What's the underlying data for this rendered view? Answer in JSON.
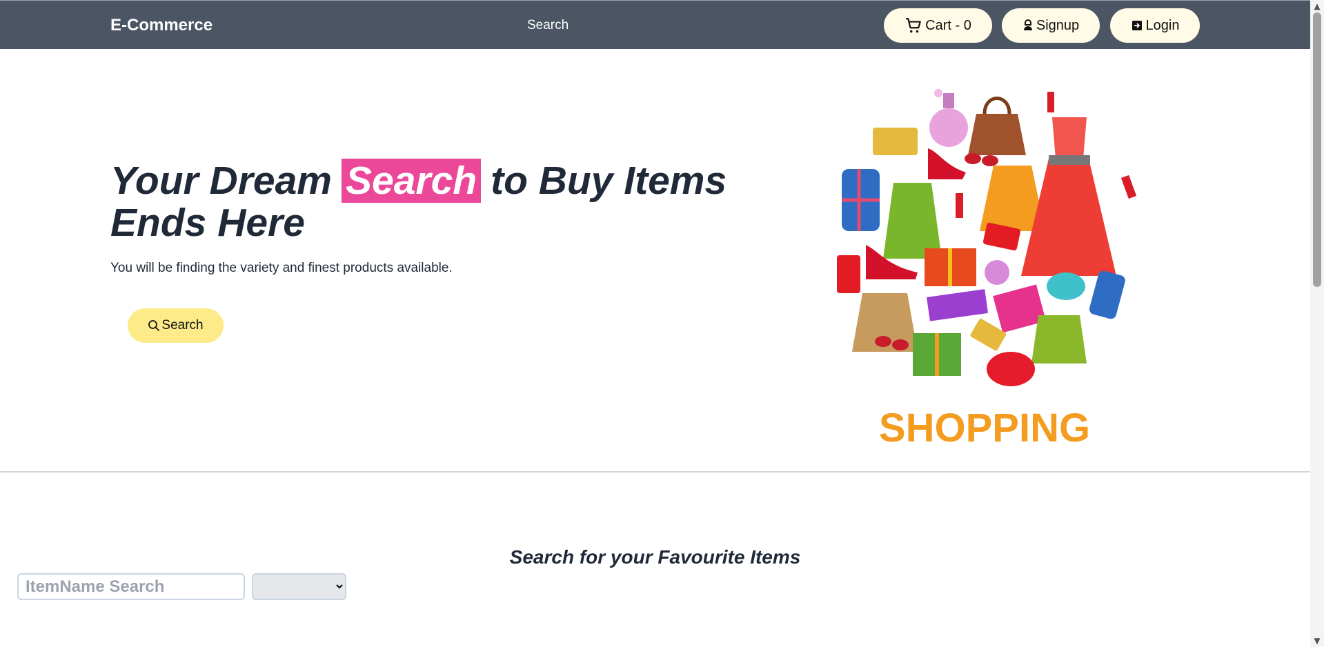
{
  "navbar": {
    "brand": "E-Commerce",
    "search_link": "Search",
    "cart_label": "Cart - 0",
    "signup_label": "Signup",
    "login_label": "Login"
  },
  "hero": {
    "title_before": "Your Dream",
    "title_highlight": "Search",
    "title_after": "to Buy Items Ends Here",
    "subtitle": "You will be finding the variety and finest products available.",
    "button_label": "Search",
    "highlight_color": "#ec4899",
    "button_color": "#fdeb8a",
    "image_caption": "SHOPPING"
  },
  "search_section": {
    "title": "Search for your Favourite Items",
    "input_placeholder": "ItemName Search",
    "select_value": ""
  },
  "colors": {
    "navbar_bg": "#4b5563",
    "pill_bg": "#fffbe6"
  }
}
